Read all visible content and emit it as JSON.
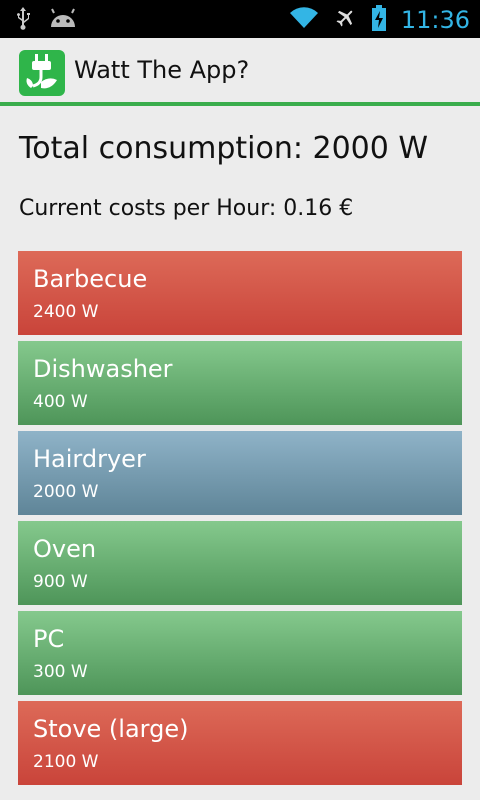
{
  "status_bar": {
    "time": "11:36",
    "icons": [
      "usb-icon",
      "android-icon",
      "wifi-icon",
      "airplane-mode-icon",
      "battery-charging-icon"
    ]
  },
  "action_bar": {
    "title": "Watt The App?",
    "icon": "plug-leaf-icon"
  },
  "summary": {
    "total": "Total consumption: 2000 W",
    "costs": "Current costs per Hour: 0.16 €"
  },
  "colors": {
    "red": "#cc4b3d",
    "green": "#5da468",
    "blue": "#6b90a3",
    "accent": "#3aad4c",
    "status_blue": "#33b5e5"
  },
  "devices": [
    {
      "name": "Barbecue",
      "power": "2400 W",
      "color": "red"
    },
    {
      "name": "Dishwasher",
      "power": "400 W",
      "color": "green"
    },
    {
      "name": "Hairdryer",
      "power": "2000 W",
      "color": "blue"
    },
    {
      "name": "Oven",
      "power": "900 W",
      "color": "green"
    },
    {
      "name": "PC",
      "power": "300 W",
      "color": "green"
    },
    {
      "name": "Stove (large)",
      "power": "2100 W",
      "color": "red"
    }
  ]
}
